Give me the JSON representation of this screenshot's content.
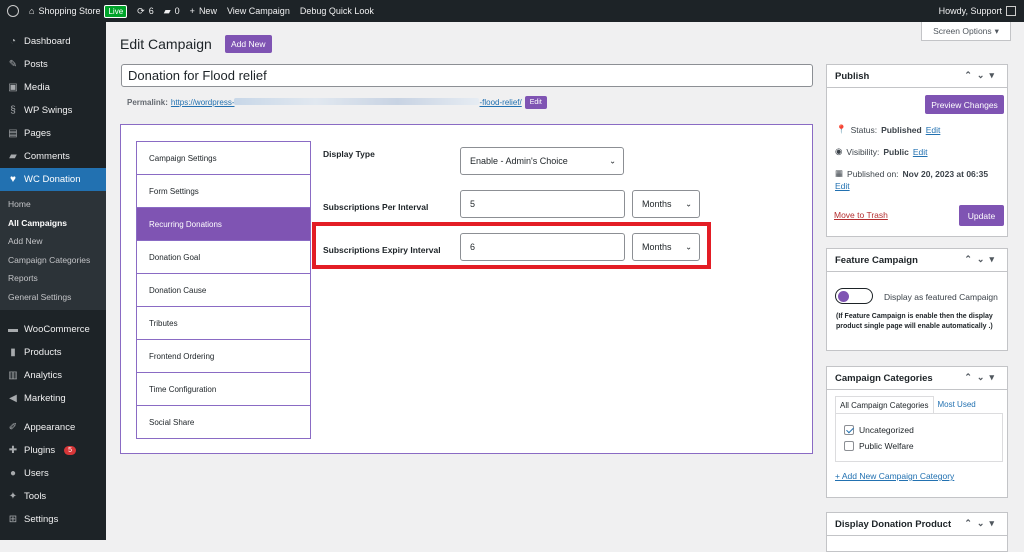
{
  "adminbar": {
    "site_name": "Shopping Store",
    "live_badge": "Live",
    "updates_count": "6",
    "comments_count": "0",
    "new_label": "New",
    "view_campaign": "View Campaign",
    "debug": "Debug Quick Look",
    "howdy": "Howdy, Support"
  },
  "sidebar": {
    "items_top": [
      {
        "label": "Dashboard",
        "icon": "dashboard-icon"
      },
      {
        "label": "Posts",
        "icon": "pin-icon"
      },
      {
        "label": "Media",
        "icon": "media-icon"
      },
      {
        "label": "WP Swings",
        "icon": "swings-icon"
      },
      {
        "label": "Pages",
        "icon": "pages-icon"
      },
      {
        "label": "Comments",
        "icon": "comment-icon"
      },
      {
        "label": "WC Donation",
        "icon": "heart-icon"
      }
    ],
    "submenu": [
      "Home",
      "All Campaigns",
      "Add New",
      "Campaign Categories",
      "Reports",
      "General Settings"
    ],
    "items_bottom": [
      {
        "label": "WooCommerce",
        "icon": "woo-icon"
      },
      {
        "label": "Products",
        "icon": "products-icon"
      },
      {
        "label": "Analytics",
        "icon": "analytics-icon"
      },
      {
        "label": "Marketing",
        "icon": "megaphone-icon"
      },
      {
        "label": "Appearance",
        "icon": "brush-icon"
      },
      {
        "label": "Plugins",
        "icon": "plugin-icon",
        "badge": "5"
      },
      {
        "label": "Users",
        "icon": "users-icon"
      },
      {
        "label": "Tools",
        "icon": "wrench-icon"
      },
      {
        "label": "Settings",
        "icon": "settings-icon"
      }
    ]
  },
  "header": {
    "title": "Edit Campaign",
    "add_new": "Add New",
    "screen_options": "Screen Options"
  },
  "post": {
    "title": "Donation for Flood relief",
    "permalink_label": "Permalink:",
    "permalink_start": "https://wordpress-",
    "permalink_end": "-flood-relief/",
    "permalink_edit": "Edit"
  },
  "tabs": [
    "Campaign Settings",
    "Form Settings",
    "Recurring Donations",
    "Donation Goal",
    "Donation Cause",
    "Tributes",
    "Frontend Ordering",
    "Time Configuration",
    "Social Share"
  ],
  "form": {
    "display_type_label": "Display Type",
    "display_type_value": "Enable - Admin's Choice",
    "subs_per_interval_label": "Subscriptions Per Interval",
    "subs_per_interval_value": "5",
    "subs_per_interval_unit": "Months",
    "subs_expiry_label": "Subscriptions Expiry Interval",
    "subs_expiry_value": "6",
    "subs_expiry_unit": "Months"
  },
  "publish": {
    "title": "Publish",
    "preview": "Preview Changes",
    "status_label": "Status:",
    "status_value": "Published",
    "visibility_label": "Visibility:",
    "visibility_value": "Public",
    "published_label": "Published on:",
    "published_value": "Nov 20, 2023 at 06:35",
    "edit": "Edit",
    "trash": "Move to Trash",
    "update": "Update"
  },
  "feature": {
    "title": "Feature Campaign",
    "toggle_label": "Display as featured Campaign",
    "note": "(If Feature Campaign is enable then the display product single page will enable automatically .)"
  },
  "categories": {
    "title": "Campaign Categories",
    "tab_all": "All Campaign Categories",
    "tab_most": "Most Used",
    "items": [
      {
        "label": "Uncategorized",
        "checked": true
      },
      {
        "label": "Public Welfare",
        "checked": false
      }
    ],
    "add_new": "+ Add New Campaign Category"
  },
  "display_product": {
    "title": "Display Donation Product"
  },
  "colors": {
    "accent": "#7f54b3",
    "highlight": "#e31d25",
    "admin_bg": "#1d2327",
    "active_menu": "#2271b1"
  }
}
